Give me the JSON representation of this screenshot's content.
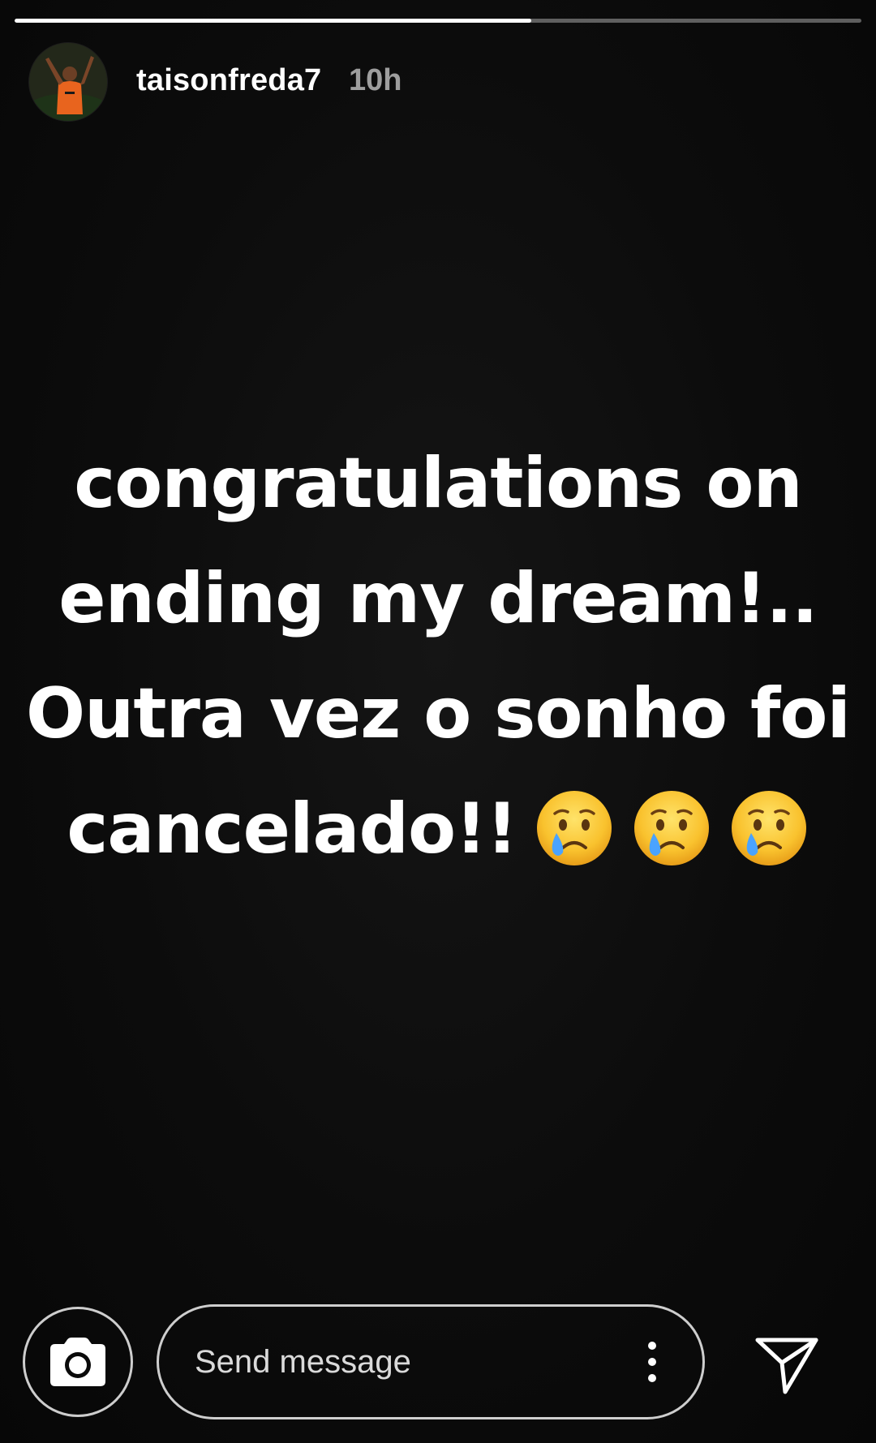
{
  "story": {
    "progress": 0.61,
    "username": "taisonfreda7",
    "timestamp": "10h",
    "text_lines": [
      "congratulations on",
      "ending my dream!..",
      "Outra vez o sonho foi",
      "cancelado!!"
    ],
    "emojis": [
      "crying-face-icon",
      "crying-face-icon",
      "crying-face-icon"
    ]
  },
  "footer": {
    "message_placeholder": "Send message",
    "camera_icon": "camera-icon",
    "more_icon": "more-vertical-icon",
    "send_icon": "send-icon"
  },
  "colors": {
    "background": "#0a0a0a",
    "text": "#ffffff",
    "timestamp": "rgba(255,255,255,0.6)"
  }
}
